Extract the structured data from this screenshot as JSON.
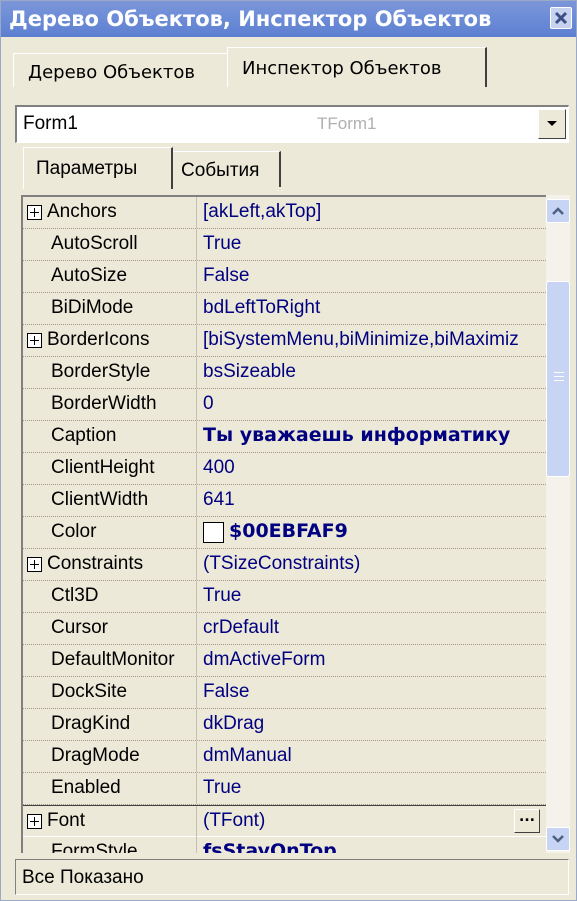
{
  "window": {
    "title": "Дерево Объектов, Инспектор Объектов"
  },
  "top_tabs": [
    {
      "label": "Дерево Объектов",
      "active": false
    },
    {
      "label": "Инспектор Объектов",
      "active": true
    }
  ],
  "object_selector": {
    "name": "Form1",
    "type": "TForm1"
  },
  "sub_tabs": [
    {
      "label": "Параметры",
      "active": true
    },
    {
      "label": "События",
      "active": false
    }
  ],
  "properties": [
    {
      "name": "Anchors",
      "value": "[akLeft,akTop]",
      "expandable": true
    },
    {
      "name": "AutoScroll",
      "value": "True"
    },
    {
      "name": "AutoSize",
      "value": "False"
    },
    {
      "name": "BiDiMode",
      "value": "bdLeftToRight"
    },
    {
      "name": "BorderIcons",
      "value": "[biSystemMenu,biMinimize,biMaximiz",
      "expandable": true
    },
    {
      "name": "BorderStyle",
      "value": "bsSizeable"
    },
    {
      "name": "BorderWidth",
      "value": "0"
    },
    {
      "name": "Caption",
      "value": "Ты уважаешь информатику",
      "bold": true
    },
    {
      "name": "ClientHeight",
      "value": "400"
    },
    {
      "name": "ClientWidth",
      "value": "641"
    },
    {
      "name": "Color",
      "value": "$00EBFAF9",
      "bold": true,
      "swatch": "#ffffff"
    },
    {
      "name": "Constraints",
      "value": "(TSizeConstraints)",
      "expandable": true
    },
    {
      "name": "Ctl3D",
      "value": "True"
    },
    {
      "name": "Cursor",
      "value": "crDefault"
    },
    {
      "name": "DefaultMonitor",
      "value": "dmActiveForm"
    },
    {
      "name": "DockSite",
      "value": "False"
    },
    {
      "name": "DragKind",
      "value": "dkDrag"
    },
    {
      "name": "DragMode",
      "value": "dmManual"
    },
    {
      "name": "Enabled",
      "value": "True"
    },
    {
      "name": "Font",
      "value": "(TFont)",
      "expandable": true,
      "selected": true,
      "ellipsis": "..."
    },
    {
      "name": "FormStyle",
      "value": "fsStayOnTop",
      "bold": true
    }
  ],
  "status_bar": {
    "text": "Все Показано"
  },
  "colors": {
    "title_bar": "#6f8ed8",
    "window_bg": "#ece9d8",
    "value_text": "#000080"
  }
}
